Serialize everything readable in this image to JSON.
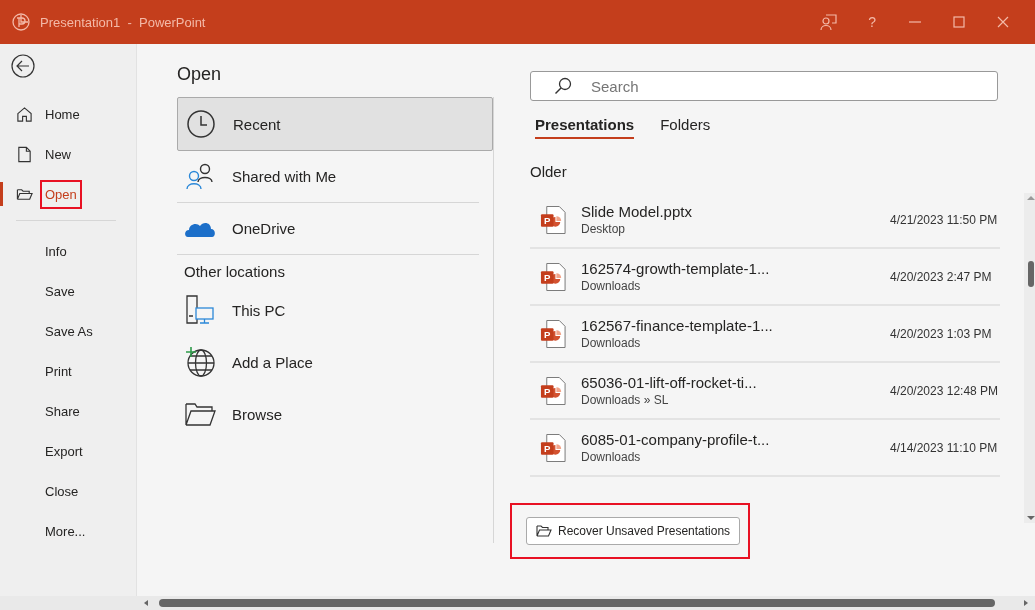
{
  "window": {
    "title": "Presentation1  -  PowerPoint"
  },
  "title_buttons": [
    {
      "kind": "coauthor"
    },
    {
      "kind": "help",
      "label": "?"
    },
    {
      "kind": "minimize"
    },
    {
      "kind": "maximize"
    },
    {
      "kind": "close"
    }
  ],
  "sidebar": {
    "items": [
      {
        "label": "Home",
        "kind": "home",
        "selected": false,
        "highlighted": false
      },
      {
        "label": "New",
        "kind": "new",
        "selected": false,
        "highlighted": false
      },
      {
        "label": "Open",
        "kind": "open",
        "selected": true,
        "highlighted": true
      },
      {
        "label": "Info",
        "kind": "text",
        "selected": false,
        "highlighted": false
      },
      {
        "label": "Save",
        "kind": "text",
        "selected": false,
        "highlighted": false
      },
      {
        "label": "Save As",
        "kind": "text",
        "selected": false,
        "highlighted": false
      },
      {
        "label": "Print",
        "kind": "text",
        "selected": false,
        "highlighted": false
      },
      {
        "label": "Share",
        "kind": "text",
        "selected": false,
        "highlighted": false
      },
      {
        "label": "Export",
        "kind": "text",
        "selected": false,
        "highlighted": false
      },
      {
        "label": "Close",
        "kind": "text",
        "selected": false,
        "highlighted": false
      },
      {
        "label": "More...",
        "kind": "text",
        "selected": false,
        "highlighted": false
      }
    ]
  },
  "page_title": "Open",
  "locations": [
    {
      "kind": "recent",
      "label": "Recent",
      "selected": true
    },
    {
      "kind": "shared",
      "label": "Shared with Me",
      "selected": false
    },
    {
      "kind": "onedrive",
      "label": "OneDrive",
      "selected": false
    },
    {
      "kind": "header",
      "label": "Other locations"
    },
    {
      "kind": "pc",
      "label": "This PC",
      "selected": false
    },
    {
      "kind": "place",
      "label": "Add a Place",
      "selected": false
    },
    {
      "kind": "browse",
      "label": "Browse",
      "selected": false
    }
  ],
  "search": {
    "placeholder": "Search"
  },
  "tabs": [
    {
      "label": "Presentations",
      "selected": true
    },
    {
      "label": "Folders",
      "selected": false
    }
  ],
  "section": "Older",
  "files": [
    {
      "icon_letter": "P",
      "name": "Slide Model.pptx",
      "location": "Desktop",
      "date": "4/21/2023 11:50 PM"
    },
    {
      "icon_letter": "P",
      "name": "162574-growth-template-1...",
      "location": "Downloads",
      "date": "4/20/2023 2:47 PM"
    },
    {
      "icon_letter": "P",
      "name": "162567-finance-template-1...",
      "location": "Downloads",
      "date": "4/20/2023 1:03 PM"
    },
    {
      "icon_letter": "P",
      "name": "65036-01-lift-off-rocket-ti...",
      "location": "Downloads » SL",
      "date": "4/20/2023 12:48 PM"
    },
    {
      "icon_letter": "P",
      "name": "6085-01-company-profile-t...",
      "location": "Downloads",
      "date": "4/14/2023 11:10 PM"
    }
  ],
  "recover_button": {
    "label": "Recover Unsaved Presentations",
    "highlighted": true
  }
}
